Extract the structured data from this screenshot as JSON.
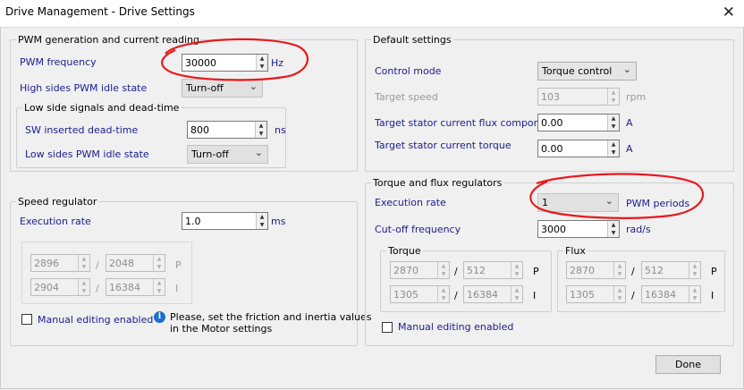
{
  "window": {
    "title": "Drive Management - Drive Settings",
    "close_glyph": "✕"
  },
  "pwm": {
    "legend": "PWM generation and current reading",
    "freq_label": "PWM frequency",
    "freq_value": "30000",
    "freq_unit": "Hz",
    "high_label": "High sides PWM idle state",
    "high_value": "Turn-off",
    "low": {
      "legend": "Low side signals and dead-time",
      "dead_label": "SW inserted dead-time",
      "dead_value": "800",
      "dead_unit": "ns",
      "idle_label": "Low sides PWM idle state",
      "idle_value": "Turn-off"
    }
  },
  "defaults": {
    "legend": "Default settings",
    "mode_label": "Control mode",
    "mode_value": "Torque control",
    "speed_label": "Target speed",
    "speed_value": "103",
    "speed_unit": "rpm",
    "flux_label": "Target stator current flux component",
    "flux_value": "0.00",
    "flux_unit": "A",
    "torque_label": "Target stator current torque",
    "torque_value": "0.00",
    "torque_unit": "A"
  },
  "speed_reg": {
    "legend": "Speed regulator",
    "rate_label": "Execution rate",
    "rate_value": "1.0",
    "rate_unit": "ms",
    "p_num": "2896",
    "p_den": "2048",
    "p_label": "P",
    "i_num": "2904",
    "i_den": "16384",
    "i_label": "I",
    "slash": "/",
    "manual_label": "Manual editing enabled",
    "info_glyph": "i",
    "info_line1": "Please, set the friction and inertia values",
    "info_line2": "in the Motor settings"
  },
  "tf_reg": {
    "legend": "Torque and flux regulators",
    "rate_label": "Execution rate",
    "rate_value": "1",
    "rate_unit": "PWM periods",
    "cutoff_label": "Cut-off frequency",
    "cutoff_value": "3000",
    "cutoff_unit": "rad/s",
    "torque": {
      "legend": "Torque",
      "p_num": "2870",
      "p_den": "512",
      "p_label": "P",
      "i_num": "1305",
      "i_den": "16384",
      "i_label": "I"
    },
    "flux": {
      "legend": "Flux",
      "p_num": "2870",
      "p_den": "512",
      "p_label": "P",
      "i_num": "1305",
      "i_den": "16384",
      "i_label": "I"
    },
    "slash": "/",
    "manual_label": "Manual editing enabled"
  },
  "done_label": "Done",
  "colors": {
    "label_blue": "#1b1b8f",
    "disabled_gray": "#9a9a9a",
    "annotation_red": "#e8191c",
    "info_blue": "#1e6fd0"
  }
}
